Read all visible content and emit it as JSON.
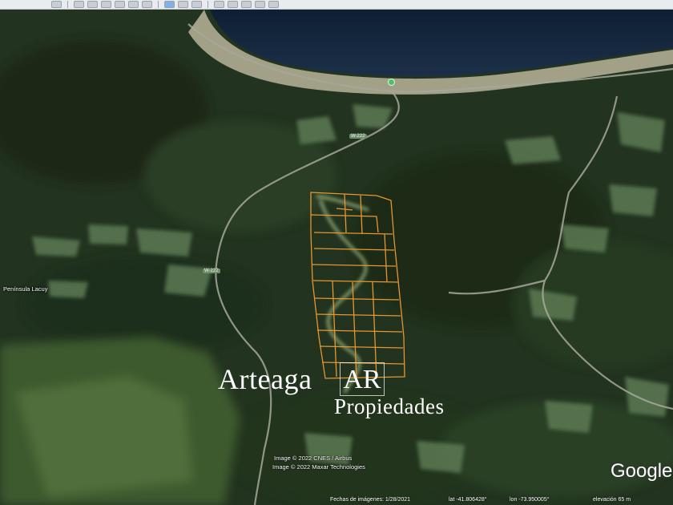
{
  "toolbar": {
    "buttons": [
      "search-icon",
      "hand-icon",
      "placemark-icon",
      "polygon-icon",
      "path-icon",
      "overlay-icon",
      "tour-icon",
      "earth-icon",
      "sun-icon",
      "planets-icon",
      "ruler-icon",
      "email-icon",
      "print-icon",
      "save-image-icon",
      "maps-icon"
    ]
  },
  "map": {
    "road_labels": [
      "W-222",
      "W-222"
    ],
    "place_label": "Península Lacuy",
    "credits": [
      "Image © 2022 CNES / Airbus",
      "Image © 2022 Maxar Technologies"
    ],
    "logo": "Google"
  },
  "watermark": {
    "line1": "Arteaga",
    "monogram": "AR",
    "line2": "Propiedades"
  },
  "status": {
    "imagery_date": "Fechas de imágenes: 1/28/2021",
    "lat": "lat  -41.806428°",
    "lon": "lon  -73.950005°",
    "elevation": "elevación  65 m"
  },
  "colors": {
    "parcel_outline": "#e8962e",
    "inner_path": "#c9e6a0",
    "sea": "#13243a",
    "forest": "#22331f",
    "pasture": "#5b7a52"
  }
}
